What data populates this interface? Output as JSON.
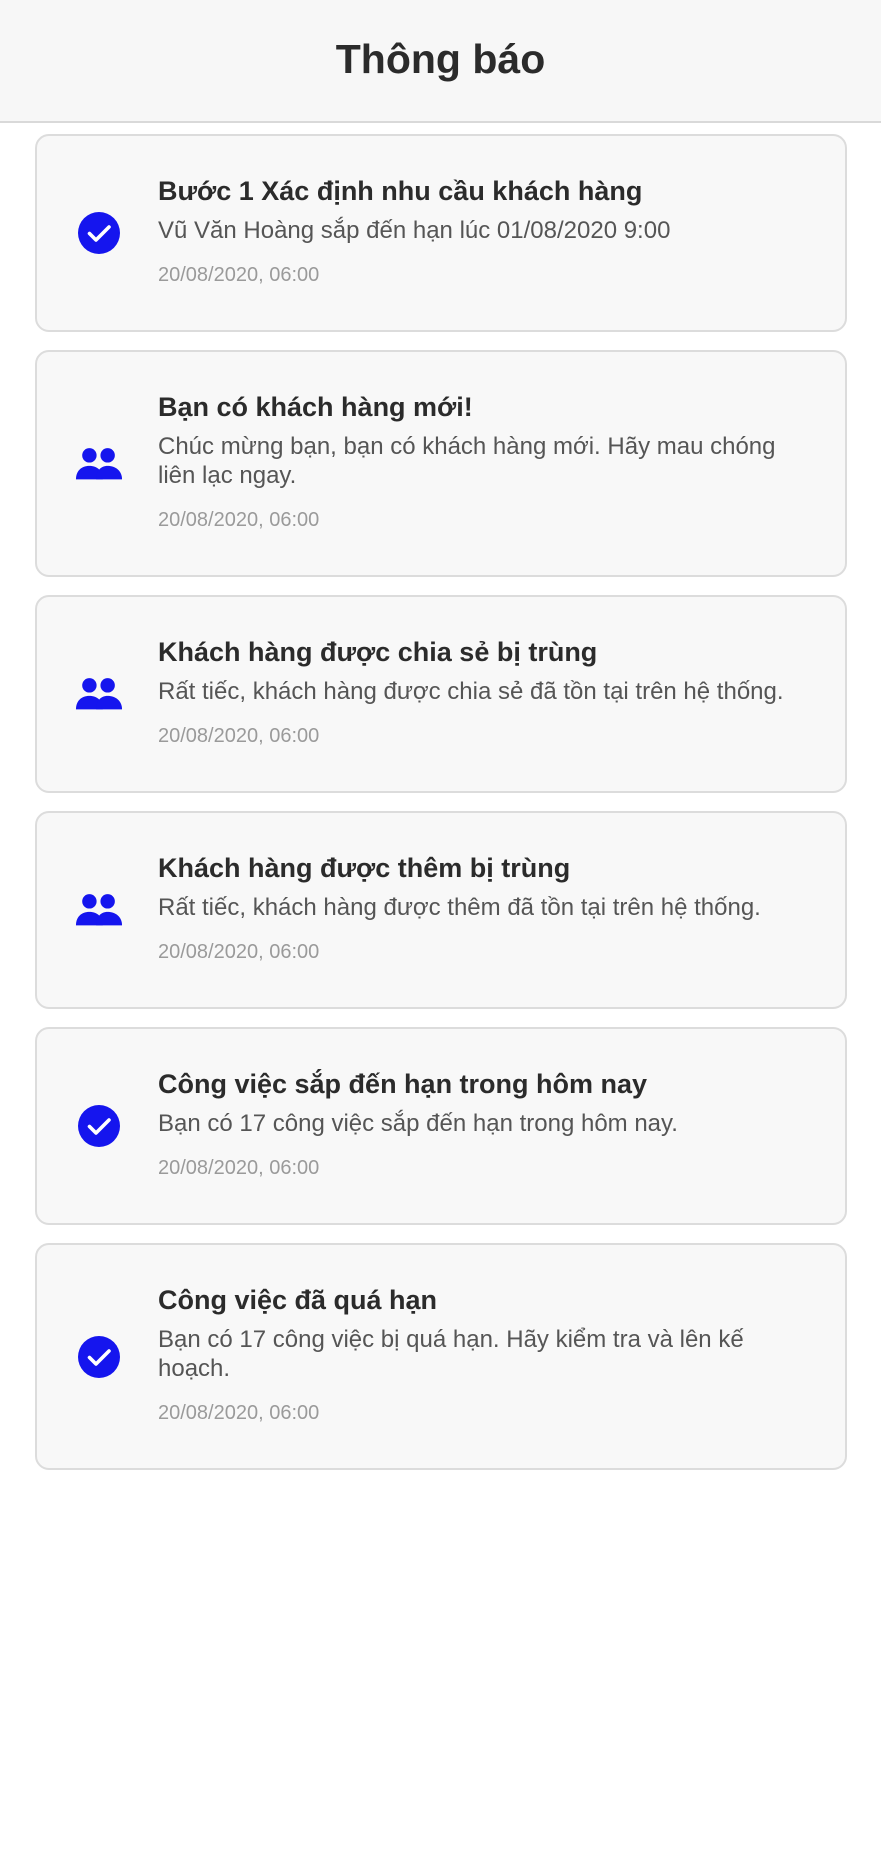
{
  "header": {
    "title": "Thông báo"
  },
  "colors": {
    "accent": "#1515ee",
    "header_bg": "#f7f7f7",
    "card_bg": "#f8f8f8"
  },
  "notifications": [
    {
      "icon": "check-circle-icon",
      "title": "Bước 1 Xác định nhu cầu khách hàng",
      "body": "Vũ Văn Hoàng sắp đến hạn lúc 01/08/2020 9:00",
      "time": "20/08/2020, 06:00"
    },
    {
      "icon": "users-icon",
      "title": "Bạn có khách hàng mới!",
      "body": "Chúc mừng bạn, bạn có khách hàng mới. Hãy mau chóng liên lạc ngay.",
      "time": "20/08/2020, 06:00"
    },
    {
      "icon": "users-icon",
      "title": "Khách hàng được chia sẻ bị trùng",
      "body": "Rất tiếc, khách hàng được chia sẻ đã tồn tại trên hệ thống.",
      "time": "20/08/2020, 06:00"
    },
    {
      "icon": "users-icon",
      "title": "Khách hàng được thêm bị trùng",
      "body": "Rất tiếc, khách hàng được thêm đã tồn tại trên hệ thống.",
      "time": "20/08/2020, 06:00"
    },
    {
      "icon": "check-circle-icon",
      "title": "Công việc sắp đến hạn trong hôm nay",
      "body": "Bạn có 17 công việc sắp đến hạn trong hôm nay.",
      "time": "20/08/2020, 06:00"
    },
    {
      "icon": "check-circle-icon",
      "title": "Công việc đã quá hạn",
      "body": "Bạn có 17 công việc bị quá hạn. Hãy kiểm tra và lên kế hoạch.",
      "time": "20/08/2020, 06:00"
    }
  ]
}
